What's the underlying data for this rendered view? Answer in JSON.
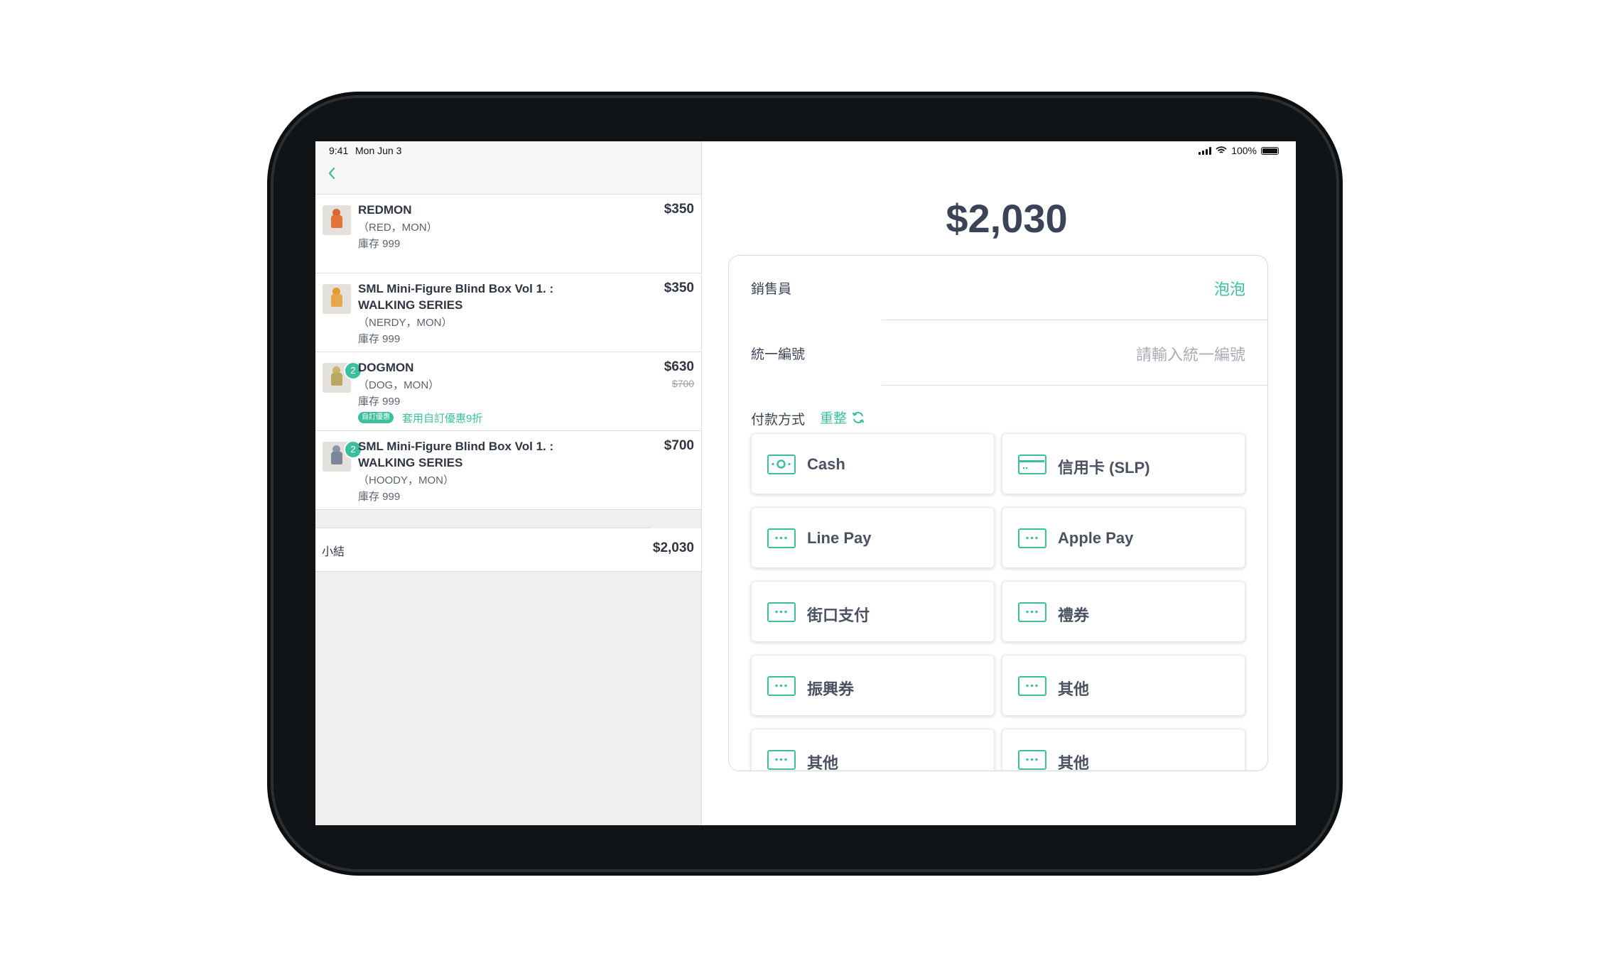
{
  "status_bar": {
    "time": "9:41",
    "date": "Mon Jun 3",
    "battery": "100%"
  },
  "cart": {
    "items": [
      {
        "name": "REDMON",
        "variant": "（RED，MON）",
        "stock": "庫存 999",
        "price": "$350"
      },
      {
        "name": "SML Mini-Figure Blind Box Vol 1. : WALKING SERIES",
        "variant": "（NERDY，MON）",
        "stock": "庫存 999",
        "price": "$350"
      },
      {
        "name": "DOGMON",
        "variant": "（DOG，MON）",
        "stock": "庫存 999",
        "price": "$630",
        "original_price": "$700",
        "quantity": "2",
        "promo_tag": "自訂優惠",
        "promo_text": "套用自訂優惠9折"
      },
      {
        "name": "SML Mini-Figure Blind Box Vol 1. : WALKING SERIES",
        "variant": "（HOODY，MON）",
        "stock": "庫存 999",
        "price": "$700",
        "quantity": "2"
      }
    ],
    "subtotal_label": "小結",
    "subtotal_value": "$2,030"
  },
  "checkout": {
    "total": "$2,030",
    "salesperson_label": "銷售員",
    "salesperson_value": "泡泡",
    "tax_id_label": "統一編號",
    "tax_id_placeholder": "請輸入統一編號",
    "payment_label": "付款方式",
    "reset_label": "重整",
    "payment_methods": [
      "Cash",
      "信用卡 (SLP)",
      "Line Pay",
      "Apple Pay",
      "街口支付",
      "禮券",
      "振興券",
      "其他",
      "其他",
      "其他"
    ]
  },
  "colors": {
    "accent": "#3cbf9c",
    "text": "#3c4555",
    "background": "#efefef"
  }
}
